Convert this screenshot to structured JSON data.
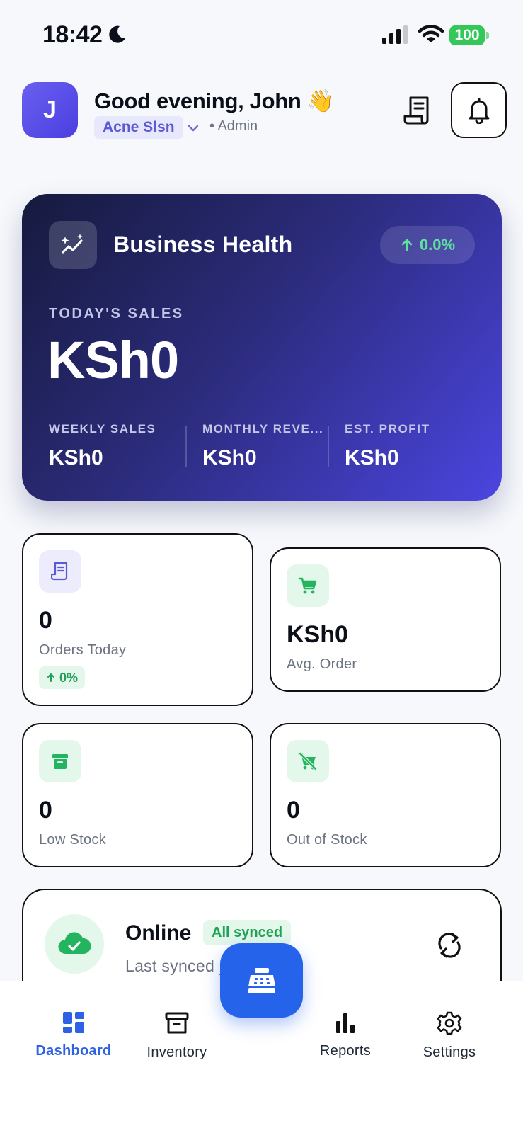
{
  "status_bar": {
    "time": "18:42",
    "battery": "100"
  },
  "header": {
    "avatar_initial": "J",
    "greeting": "Good evening, John 👋",
    "store_name": "Acne Slsn",
    "role": "• Admin"
  },
  "health": {
    "title": "Business Health",
    "trend": "0.0%",
    "todays_label": "TODAY'S SALES",
    "todays_value": "KSh0",
    "mini_stats": [
      {
        "label": "WEEKLY SALES",
        "value": "KSh0"
      },
      {
        "label": "MONTHLY REVE...",
        "value": "KSh0"
      },
      {
        "label": "EST. PROFIT",
        "value": "KSh0"
      }
    ]
  },
  "stats": {
    "orders": {
      "value": "0",
      "label": "Orders Today",
      "badge": "0%"
    },
    "avg_order": {
      "value": "KSh0",
      "label": "Avg. Order"
    },
    "low_stock": {
      "value": "0",
      "label": "Low Stock"
    },
    "out_of_stock": {
      "value": "0",
      "label": "Out of Stock"
    }
  },
  "sync": {
    "status": "Online",
    "badge": "All synced",
    "last_synced": "Last synced just now"
  },
  "nav": {
    "items": [
      {
        "label": "Dashboard",
        "icon": "dashboard-icon",
        "active": true
      },
      {
        "label": "Inventory",
        "icon": "archive-box-icon",
        "active": false
      },
      {
        "label": "Reports",
        "icon": "bar-chart-icon",
        "active": false
      },
      {
        "label": "Settings",
        "icon": "gear-icon",
        "active": false
      }
    ],
    "fab_icon": "cash-register-icon"
  },
  "colors": {
    "accent": "#2563eb",
    "brand_purple": "#5b5ad6",
    "success_green": "#22a05a",
    "card_gradient_start": "#161a3d",
    "card_gradient_end": "#4b45e0"
  }
}
